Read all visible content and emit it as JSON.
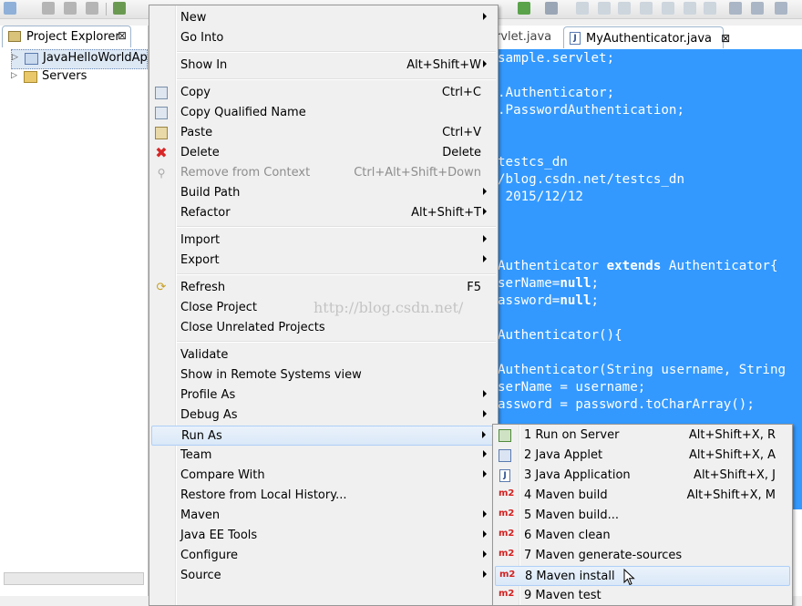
{
  "explorer": {
    "tab_label": "Project Explorer",
    "tab_close": "⊠",
    "items": [
      {
        "label": "JavaHelloWorldApp"
      },
      {
        "label": "Servers"
      }
    ]
  },
  "editor": {
    "tabs": [
      {
        "label": "rvlet.java"
      },
      {
        "label": "MyAuthenticator.java",
        "close": "⊠"
      }
    ],
    "code_lines": [
      "sample.servlet;",
      "",
      ".Authenticator;",
      ".PasswordAuthentication;",
      "",
      "",
      "testcs_dn",
      "/blog.csdn.net/testcs_dn",
      " 2015/12/12",
      "",
      "",
      "",
      "Authenticator extends Authenticator{",
      "serName=null;",
      "assword=null;",
      "",
      "Authenticator(){",
      "",
      "Authenticator(String username, String",
      "serName = username;",
      "assword = password.toCharArray();"
    ],
    "selection_color": "#3399ff"
  },
  "context_menu": {
    "items": [
      {
        "label": "New",
        "submenu": true
      },
      {
        "label": "Go Into"
      },
      {
        "label": "Show In",
        "shortcut": "Alt+Shift+W",
        "submenu": true
      },
      {
        "label": "Copy",
        "shortcut": "Ctrl+C",
        "icon": "copy-icon"
      },
      {
        "label": "Copy Qualified Name",
        "icon": "copy-qualified-icon"
      },
      {
        "label": "Paste",
        "shortcut": "Ctrl+V",
        "icon": "paste-icon"
      },
      {
        "label": "Delete",
        "shortcut": "Delete",
        "icon": "delete-icon"
      },
      {
        "label": "Remove from Context",
        "shortcut": "Ctrl+Alt+Shift+Down",
        "disabled": true,
        "icon": "remove-context-icon"
      },
      {
        "label": "Build Path",
        "submenu": true
      },
      {
        "label": "Refactor",
        "shortcut": "Alt+Shift+T",
        "submenu": true
      },
      {
        "label": "Import",
        "submenu": true
      },
      {
        "label": "Export",
        "submenu": true
      },
      {
        "label": "Refresh",
        "shortcut": "F5",
        "icon": "refresh-icon"
      },
      {
        "label": "Close Project"
      },
      {
        "label": "Close Unrelated Projects"
      },
      {
        "label": "Validate"
      },
      {
        "label": "Show in Remote Systems view"
      },
      {
        "label": "Profile As",
        "submenu": true
      },
      {
        "label": "Debug As",
        "submenu": true
      },
      {
        "label": "Run As",
        "submenu": true,
        "highlighted": true
      },
      {
        "label": "Team",
        "submenu": true
      },
      {
        "label": "Compare With",
        "submenu": true
      },
      {
        "label": "Restore from Local History..."
      },
      {
        "label": "Maven",
        "submenu": true
      },
      {
        "label": "Java EE Tools",
        "submenu": true
      },
      {
        "label": "Configure",
        "submenu": true
      },
      {
        "label": "Source",
        "submenu": true
      }
    ]
  },
  "run_as_submenu": {
    "items": [
      {
        "label": "1 Run on Server",
        "shortcut": "Alt+Shift+X, R",
        "icon": "run-server-icon"
      },
      {
        "label": "2 Java Applet",
        "shortcut": "Alt+Shift+X, A",
        "icon": "java-applet-icon"
      },
      {
        "label": "3 Java Application",
        "shortcut": "Alt+Shift+X, J",
        "icon": "java-app-icon"
      },
      {
        "label": "4 Maven build",
        "shortcut": "Alt+Shift+X, M",
        "icon": "m2"
      },
      {
        "label": "5 Maven build...",
        "icon": "m2"
      },
      {
        "label": "6 Maven clean",
        "icon": "m2"
      },
      {
        "label": "7 Maven generate-sources",
        "icon": "m2"
      },
      {
        "label": "8 Maven install",
        "icon": "m2",
        "highlighted": true
      },
      {
        "label": "9 Maven test",
        "icon": "m2"
      }
    ],
    "m2_label": "m2"
  },
  "watermark": "http://blog.csdn.net/",
  "colors": {
    "accent": "#3399ff",
    "m2_red": "#d41f1f",
    "menu_bg": "#f0f0f0"
  }
}
